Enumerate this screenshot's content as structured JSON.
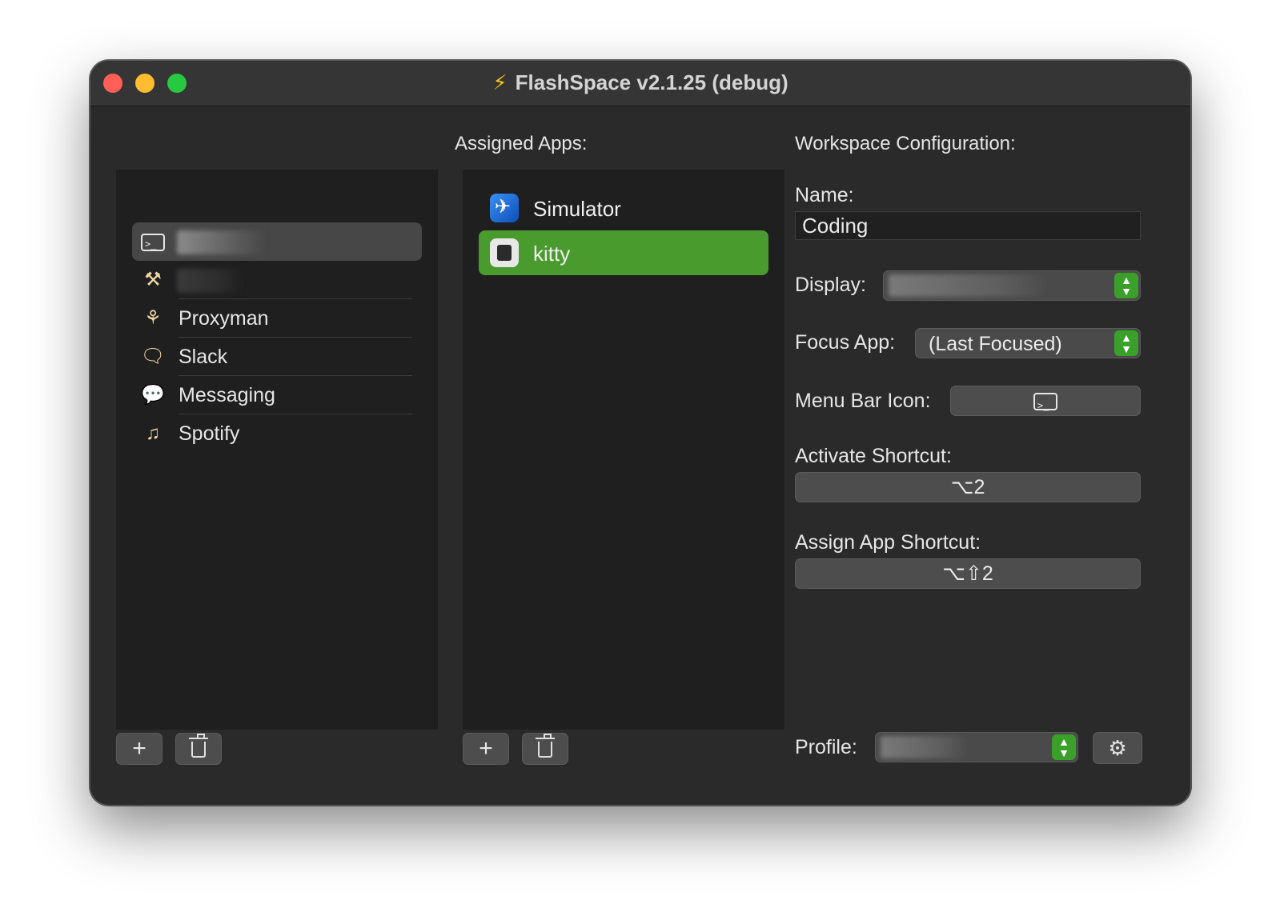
{
  "window": {
    "title": "FlashSpace v2.1.25 (debug)",
    "title_icon": "lightning-bolt-icon"
  },
  "workspaces": {
    "items": [
      {
        "label": "",
        "icon": "terminal-icon",
        "selected": true
      },
      {
        "label": "",
        "icon": "hammer-icon",
        "selected": false
      },
      {
        "label": "Proxyman",
        "icon": "proxyman-nodes-icon",
        "selected": false
      },
      {
        "label": "Slack",
        "icon": "speech-bubble-outline-icon",
        "selected": false
      },
      {
        "label": "Messaging",
        "icon": "speech-bubble-filled-icon",
        "selected": false
      },
      {
        "label": "Spotify",
        "icon": "music-list-icon",
        "selected": false
      }
    ],
    "add_label": "+",
    "delete_icon": "trash-icon"
  },
  "assigned_apps": {
    "label": "Assigned Apps:",
    "items": [
      {
        "label": "Simulator",
        "icon": "simulator-app-icon",
        "selected": false
      },
      {
        "label": "kitty",
        "icon": "kitty-app-icon",
        "selected": true
      }
    ],
    "add_label": "+",
    "delete_icon": "trash-icon"
  },
  "config": {
    "header": "Workspace Configuration:",
    "name_label": "Name:",
    "name_value": "Coding",
    "display_label": "Display:",
    "focus_app_label": "Focus App:",
    "focus_app_value": "(Last Focused)",
    "menu_bar_icon_label": "Menu Bar Icon:",
    "menu_bar_icon": "terminal-icon",
    "activate_shortcut_label": "Activate Shortcut:",
    "activate_shortcut_value": "⌥2",
    "assign_app_shortcut_label": "Assign App Shortcut:",
    "assign_app_shortcut_value": "⌥⇧2",
    "profile_label": "Profile:",
    "settings_icon": "gear-icon"
  },
  "colors": {
    "accent_green": "#4a9b2e",
    "window_bg": "#2a2a2a",
    "list_bg": "#1f1f1f"
  }
}
